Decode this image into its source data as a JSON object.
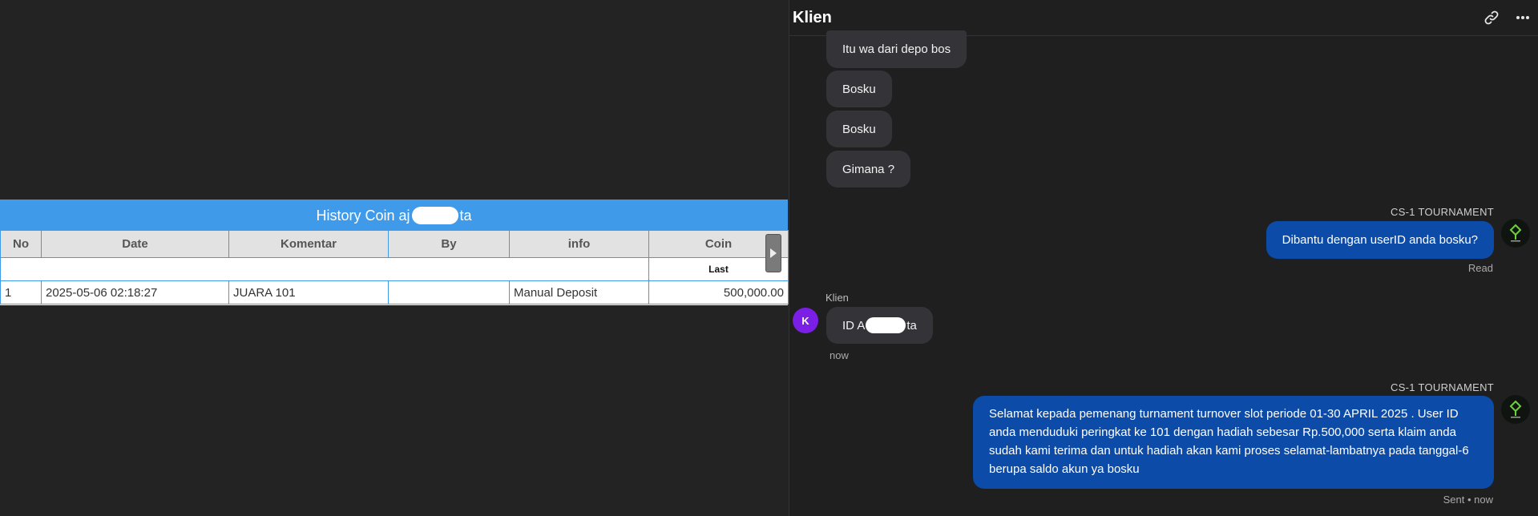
{
  "history_table": {
    "title_prefix": "History Coin aj",
    "title_suffix": "ta",
    "columns": [
      "No",
      "Date",
      "Komentar",
      "By",
      "info",
      "Coin"
    ],
    "sub_header": "Last",
    "rows": [
      {
        "no": "1",
        "date": "2025-05-06 02:18:27",
        "komentar": "JUARA 101",
        "by": "",
        "info": "Manual Deposit",
        "coin": "500,000.00"
      }
    ]
  },
  "chat": {
    "title": "Klien",
    "icons": {
      "link": "link-icon",
      "more": "more-dots-icon"
    },
    "messages": [
      {
        "dir": "in",
        "text": "Itu wa dari depo bos"
      },
      {
        "dir": "in",
        "text": "Bosku"
      },
      {
        "dir": "in",
        "text": "Bosku"
      },
      {
        "dir": "in",
        "text": "Gimana ?"
      },
      {
        "dir": "out",
        "sender": "CS-1 TOURNAMENT",
        "text": "Dibantu dengan userID anda bosku?",
        "status": "Read"
      },
      {
        "dir": "in",
        "sender": "Klien",
        "avatar": "K",
        "text_prefix": "ID A",
        "text_suffix": "ta",
        "time": "now"
      },
      {
        "dir": "out",
        "sender": "CS-1 TOURNAMENT",
        "text": "Selamat kepada pemenang turnament turnover slot periode 01-30 APRIL 2025 . User ID anda menduduki peringkat ke 101 dengan hadiah sebesar Rp.500,000 serta klaim anda sudah kami terima dan untuk hadiah akan kami proses selamat-lambatnya pada tanggal-6 berupa saldo akun ya bosku",
        "status": "Sent • now"
      }
    ]
  },
  "colors": {
    "accent": "#3f9ae9",
    "outgoing_bubble": "#0c4ba8",
    "incoming_bubble": "#343438",
    "avatar_k": "#7b1fe6",
    "coin_value": "#2e8b2e"
  }
}
